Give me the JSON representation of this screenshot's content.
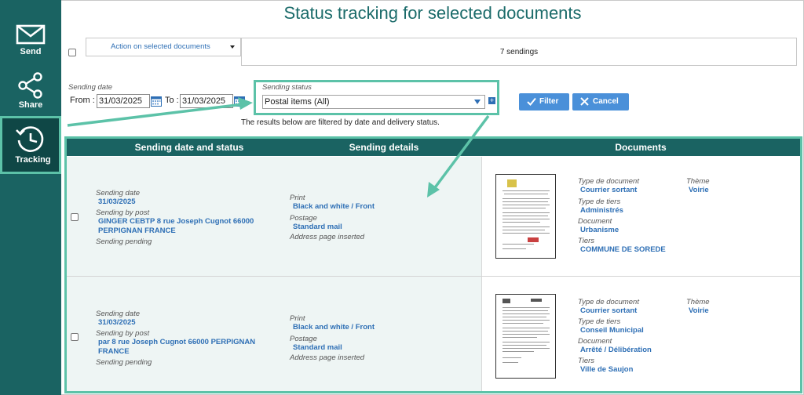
{
  "app": {
    "title": "Status tracking for selected documents"
  },
  "sidebar": {
    "items": [
      {
        "label": "Send",
        "icon": "envelope-icon"
      },
      {
        "label": "Share",
        "icon": "share-icon"
      },
      {
        "label": "Tracking",
        "icon": "history-icon"
      }
    ]
  },
  "toolbar": {
    "action_label": "Action on selected documents",
    "sendings_count": "7 sendings"
  },
  "filters": {
    "sending_date_label": "Sending date",
    "from_label": "From :",
    "from_value": "31/03/2025",
    "to_label": "To :",
    "to_value": "31/03/2025",
    "status_label": "Sending status",
    "status_value": "Postal items (All)",
    "filter_button": "Filter",
    "cancel_button": "Cancel",
    "note": "The results below are filtered by date and delivery status."
  },
  "table": {
    "headers": [
      "Sending date and status",
      "Sending details",
      "Documents"
    ],
    "rows": [
      {
        "date_label": "Sending date",
        "date_value": "31/03/2025",
        "post_label": "Sending by post",
        "post_value": "GINGER CEBTP 8 rue Joseph Cugnot 66000 PERPIGNAN FRANCE",
        "status": "Sending pending",
        "print_label": "Print",
        "print_value": "Black and white / Front",
        "postage_label": "Postage",
        "postage_value": "Standard mail",
        "address_note": "Address page inserted",
        "doc_type_label": "Type de document",
        "doc_type_value": "Courrier sortant",
        "theme_label": "Thème",
        "theme_value": "Voirie",
        "tiers_type_label": "Type de tiers",
        "tiers_type_value": "Administrés",
        "document_label": "Document",
        "document_value": "Urbanisme",
        "tiers_label": "Tiers",
        "tiers_value": "COMMUNE DE SOREDE"
      },
      {
        "date_label": "Sending date",
        "date_value": "31/03/2025",
        "post_label": "Sending by post",
        "post_value": "par 8 rue Joseph Cugnot 66000 PERPIGNAN FRANCE",
        "status": "Sending pending",
        "print_label": "Print",
        "print_value": "Black and white / Front",
        "postage_label": "Postage",
        "postage_value": "Standard mail",
        "address_note": "Address page inserted",
        "doc_type_label": "Type de document",
        "doc_type_value": "Courrier sortant",
        "theme_label": "Thème",
        "theme_value": "Voirie",
        "tiers_type_label": "Type de tiers",
        "tiers_type_value": "Conseil Municipal",
        "document_label": "Document",
        "document_value": "Arrêté / Délibération",
        "tiers_label": "Tiers",
        "tiers_value": "Ville de Saujon"
      }
    ]
  },
  "colors": {
    "sidebar": "#1a6362",
    "accent": "#5cc2a8",
    "link": "#2e6fb5",
    "button": "#4a90d9"
  }
}
